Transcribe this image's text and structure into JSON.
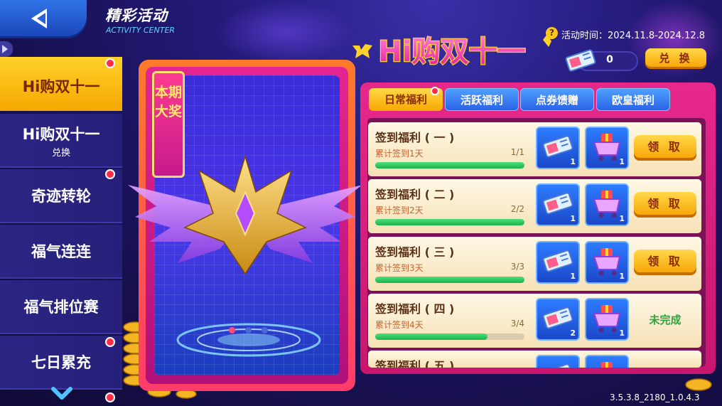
{
  "header": {
    "title_cn": "精彩活动",
    "title_en": "ACTIVITY CENTER"
  },
  "sidebar": {
    "items": [
      {
        "label": "Hi购双十一",
        "sub": "",
        "active": true
      },
      {
        "label": "Hi购双十一",
        "sub": "兑换",
        "active": false
      },
      {
        "label": "奇迹转轮",
        "sub": "",
        "active": false
      },
      {
        "label": "福气连连",
        "sub": "",
        "active": false
      },
      {
        "label": "福气排位赛",
        "sub": "",
        "active": false
      },
      {
        "label": "七日累充",
        "sub": "",
        "active": false
      }
    ]
  },
  "event": {
    "logo_text": "Hi购双十一",
    "time_label": "活动时间：2024.11.8-2024.12.8",
    "coupon_count": "0",
    "exchange_label": "兑 换"
  },
  "prize": {
    "banner": "本期大奖"
  },
  "tabs": [
    {
      "label": "日常福利",
      "active": true
    },
    {
      "label": "活跃福利",
      "active": false
    },
    {
      "label": "点券馈赠",
      "active": false
    },
    {
      "label": "欧皇福利",
      "active": false
    }
  ],
  "rewards": [
    {
      "title": "签到福利 ( 一 )",
      "sub": "累计签到1天",
      "progress_text": "1/1",
      "progress": 1.0,
      "qty1": "1",
      "qty2": "1",
      "status": "领 取"
    },
    {
      "title": "签到福利 ( 二 )",
      "sub": "累计签到2天",
      "progress_text": "2/2",
      "progress": 1.0,
      "qty1": "1",
      "qty2": "1",
      "status": "领 取"
    },
    {
      "title": "签到福利 ( 三 )",
      "sub": "累计签到3天",
      "progress_text": "3/3",
      "progress": 1.0,
      "qty1": "1",
      "qty2": "1",
      "status": "领 取"
    },
    {
      "title": "签到福利 ( 四 )",
      "sub": "累计签到4天",
      "progress_text": "3/4",
      "progress": 0.75,
      "qty1": "2",
      "qty2": "1",
      "status": "未完成"
    },
    {
      "title": "签到福利 ( 五 )",
      "sub": "",
      "progress_text": "",
      "progress": 0,
      "qty1": "",
      "qty2": "",
      "status": ""
    }
  ],
  "version": "3.5.3.8_2180_1.0.4.3",
  "colors": {
    "accent": "#ffd12a",
    "panel": "#e6288a",
    "item_blue": "#2e7cff"
  }
}
